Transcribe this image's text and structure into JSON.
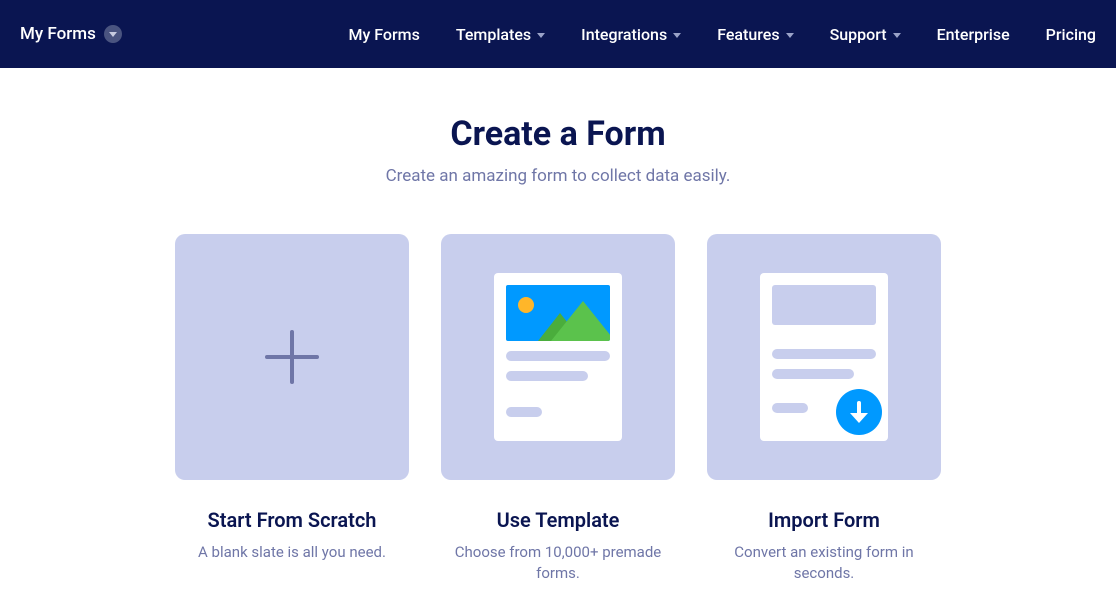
{
  "nav": {
    "left_label": "My Forms",
    "items": [
      {
        "label": "My Forms",
        "has_dropdown": false
      },
      {
        "label": "Templates",
        "has_dropdown": true
      },
      {
        "label": "Integrations",
        "has_dropdown": true
      },
      {
        "label": "Features",
        "has_dropdown": true
      },
      {
        "label": "Support",
        "has_dropdown": true
      },
      {
        "label": "Enterprise",
        "has_dropdown": false
      },
      {
        "label": "Pricing",
        "has_dropdown": false
      }
    ]
  },
  "page": {
    "title": "Create a Form",
    "subtitle": "Create an amazing form to collect data easily."
  },
  "cards": [
    {
      "title": "Start From Scratch",
      "description": "A blank slate is all you need."
    },
    {
      "title": "Use Template",
      "description": "Choose from 10,000+ premade forms."
    },
    {
      "title": "Import Form",
      "description": "Convert an existing form in seconds."
    }
  ]
}
